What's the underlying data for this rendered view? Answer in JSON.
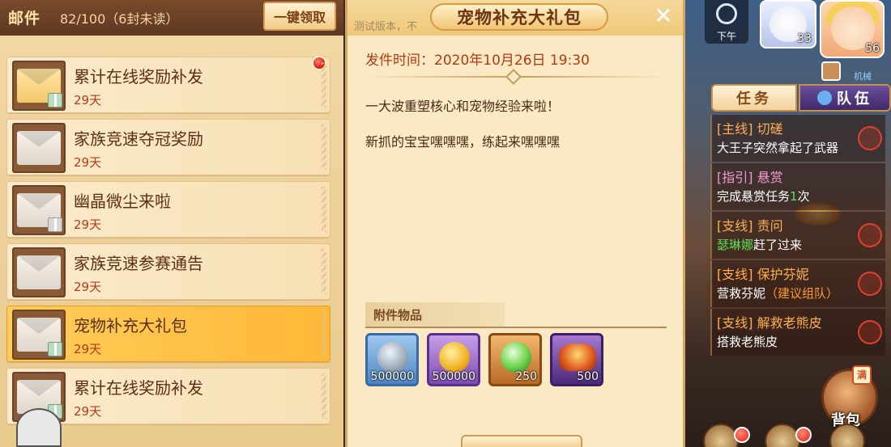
{
  "mail": {
    "title": "邮件",
    "count": "82/100（6封未读）",
    "claim_all": "一键领取",
    "items": [
      {
        "subject": "累计在线奖励补发",
        "days": "29天"
      },
      {
        "subject": "家族竞速夺冠奖励",
        "days": "29天"
      },
      {
        "subject": "幽晶微尘来啦",
        "days": "29天"
      },
      {
        "subject": "家族竞速参赛通告",
        "days": "29天"
      },
      {
        "subject": "宠物补充大礼包",
        "days": "29天"
      },
      {
        "subject": "累计在线奖励补发",
        "days": "29天"
      }
    ]
  },
  "detail": {
    "watermark": "测试版本，不",
    "title": "宠物补充大礼包",
    "close": "✕",
    "send_time": "发件时间：2020年10月26日  19:30",
    "body": [
      "一大波重塑核心和宠物经验来啦！",
      "新抓的宝宝嘿嘿嘿，练起来嘿嘿嘿"
    ],
    "attach_label": "附件物品",
    "attachments": [
      {
        "qty": "500000",
        "icon": "silver-coin"
      },
      {
        "qty": "500000",
        "icon": "gold-coin"
      },
      {
        "qty": "250",
        "icon": "green-orb"
      },
      {
        "qty": "500",
        "icon": "food-dish"
      }
    ]
  },
  "hud": {
    "time_label": "下午",
    "pet_level": "33",
    "player_level": "56",
    "small_text": "机械",
    "tab_task": "任务",
    "tab_team": "队伍",
    "quests": [
      {
        "title": "[主线] 切磋",
        "desc_pre": "大王子突然拿起了武器",
        "desc_hl": "",
        "desc_post": ""
      },
      {
        "title": "[指引] 悬赏",
        "desc_pre": "完成悬赏任务",
        "desc_hl": "1",
        "desc_post": "次"
      },
      {
        "title": "[支线] 责问",
        "desc_pre": "",
        "desc_hl": "瑟琳娜",
        "desc_post": "赶了过来"
      },
      {
        "title": "[支线] 保护芬妮",
        "desc_pre": "营救芬妮",
        "desc_hl": "（建议组队）",
        "desc_post": ""
      },
      {
        "title": "[支线] 解救老熊皮",
        "desc_pre": "搭救老熊皮",
        "desc_hl": "",
        "desc_post": ""
      }
    ],
    "bag_full": "满",
    "bag_label": "背包"
  },
  "colors": {
    "accent": "#ffb838",
    "text_red": "#b03a14",
    "panel": "#fbe9c4"
  }
}
